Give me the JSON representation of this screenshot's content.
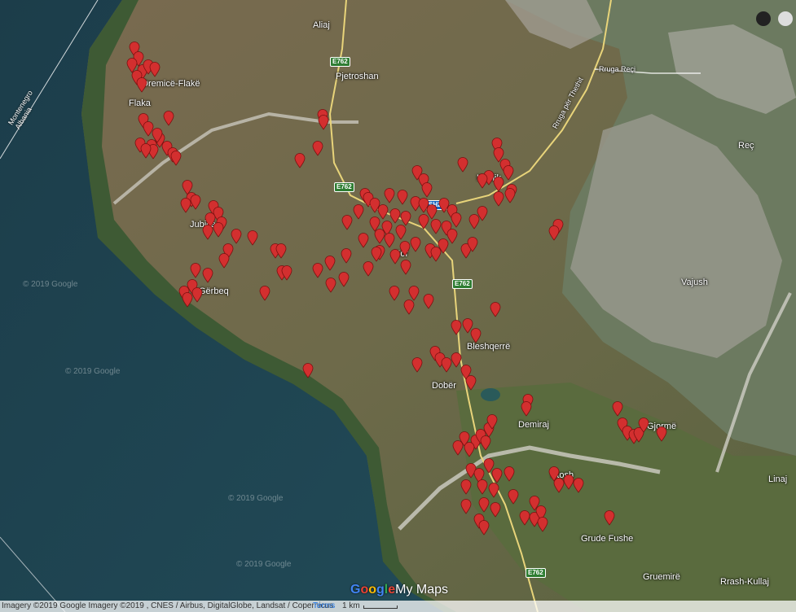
{
  "map": {
    "places": [
      {
        "key": "aliaj",
        "label": "Aliaj"
      },
      {
        "key": "pjetroshan",
        "label": "Pjetroshan"
      },
      {
        "key": "dremce",
        "label": "Dremicë-Flakë"
      },
      {
        "key": "flaka",
        "label": "Flaka"
      },
      {
        "key": "rec",
        "label": "Reç"
      },
      {
        "key": "kopliku",
        "label": "Koplik"
      },
      {
        "key": "jubice",
        "label": "Jubice"
      },
      {
        "key": "vajush",
        "label": "Vajush"
      },
      {
        "key": "kor",
        "label": "Kor"
      },
      {
        "key": "gerbeq",
        "label": "Gërbeq"
      },
      {
        "key": "bleshqerre",
        "label": "Bleshqerrë"
      },
      {
        "key": "dober",
        "label": "Dobër"
      },
      {
        "key": "demiraj",
        "label": "Demiraj"
      },
      {
        "key": "gjorme",
        "label": "Gjormë"
      },
      {
        "key": "linaj",
        "label": "Linaj"
      },
      {
        "key": "ktosh",
        "label": "Ktosh"
      },
      {
        "key": "grude",
        "label": "Grude Fushe"
      },
      {
        "key": "gruemire",
        "label": "Gruemirë"
      },
      {
        "key": "rrash",
        "label": "Rrash-Kullaj"
      },
      {
        "key": "rruga_rec",
        "label": "Rruga Reçi"
      },
      {
        "key": "rruga_thethit",
        "label": "Rruga për Thethit"
      }
    ],
    "road_shields": [
      {
        "label": "E762",
        "color": "green"
      },
      {
        "label": "E762",
        "color": "green"
      },
      {
        "label": "E762",
        "color": "green"
      },
      {
        "label": "E762",
        "color": "green"
      },
      {
        "label": "SH21",
        "color": "blue"
      }
    ],
    "border_label": "Montenegro\nAlbania",
    "watermark": "© 2019 Google",
    "pin_color": "#d32f2f",
    "pin_count": 180
  },
  "footer": {
    "copyright": "Imagery ©2019 Google Imagery ©2019 , CNES / Airbus, DigitalGlobe, Landsat / Copernicus",
    "terms": "Terms",
    "scale": "1 km",
    "logo_google": "Google",
    "logo_mymaps": "My Maps"
  }
}
